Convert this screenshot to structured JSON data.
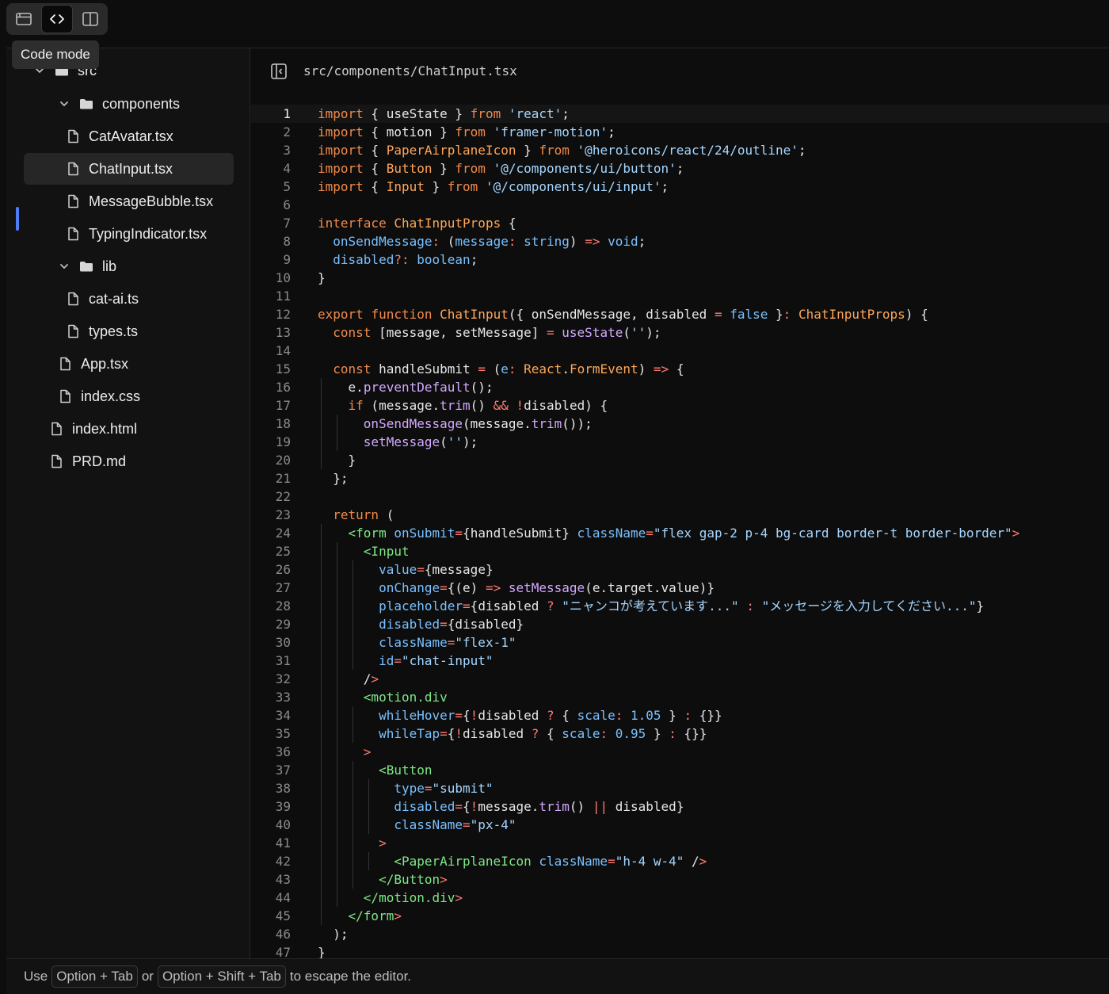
{
  "toolbar": {
    "tooltip": "Code mode",
    "buttons": [
      "browser-icon",
      "code-icon",
      "split-view-icon"
    ]
  },
  "file_tree": {
    "items": [
      {
        "label": "src",
        "type": "folder",
        "expanded": true
      },
      {
        "label": "components",
        "type": "folder",
        "expanded": true
      },
      {
        "label": "CatAvatar.tsx",
        "type": "file"
      },
      {
        "label": "ChatInput.tsx",
        "type": "file",
        "selected": true
      },
      {
        "label": "MessageBubble.tsx",
        "type": "file"
      },
      {
        "label": "TypingIndicator.tsx",
        "type": "file"
      },
      {
        "label": "lib",
        "type": "folder",
        "expanded": true
      },
      {
        "label": "cat-ai.ts",
        "type": "file"
      },
      {
        "label": "types.ts",
        "type": "file"
      },
      {
        "label": "App.tsx",
        "type": "file"
      },
      {
        "label": "index.css",
        "type": "file"
      },
      {
        "label": "index.html",
        "type": "file"
      },
      {
        "label": "PRD.md",
        "type": "file"
      }
    ]
  },
  "editor": {
    "file_path": "src/components/ChatInput.tsx",
    "current_line": 1,
    "lines": [
      "import { useState } from 'react';",
      "import { motion } from 'framer-motion';",
      "import { PaperAirplaneIcon } from '@heroicons/react/24/outline';",
      "import { Button } from '@/components/ui/button';",
      "import { Input } from '@/components/ui/input';",
      "",
      "interface ChatInputProps {",
      "  onSendMessage: (message: string) => void;",
      "  disabled?: boolean;",
      "}",
      "",
      "export function ChatInput({ onSendMessage, disabled = false }: ChatInputProps) {",
      "  const [message, setMessage] = useState('');",
      "",
      "  const handleSubmit = (e: React.FormEvent) => {",
      "    e.preventDefault();",
      "    if (message.trim() && !disabled) {",
      "      onSendMessage(message.trim());",
      "      setMessage('');",
      "    }",
      "  };",
      "",
      "  return (",
      "    <form onSubmit={handleSubmit} className=\"flex gap-2 p-4 bg-card border-t border-border\">",
      "      <Input",
      "        value={message}",
      "        onChange={(e) => setMessage(e.target.value)}",
      "        placeholder={disabled ? \"ニャンコが考えています...\" : \"メッセージを入力してください...\"}",
      "        disabled={disabled}",
      "        className=\"flex-1\"",
      "        id=\"chat-input\"",
      "      />",
      "      <motion.div",
      "        whileHover={!disabled ? { scale: 1.05 } : {}}",
      "        whileTap={!disabled ? { scale: 0.95 } : {}}",
      "      >",
      "        <Button",
      "          type=\"submit\"",
      "          disabled={!message.trim() || disabled}",
      "          className=\"px-4\"",
      "        >",
      "          <PaperAirplaneIcon className=\"h-4 w-4\" />",
      "        </Button>",
      "      </motion.div>",
      "    </form>",
      "  );",
      "}"
    ]
  },
  "status_bar": {
    "prefix": "Use",
    "key1": "Option + Tab",
    "middle": "or",
    "key2": "Option + Shift + Tab",
    "suffix": "to escape the editor."
  }
}
